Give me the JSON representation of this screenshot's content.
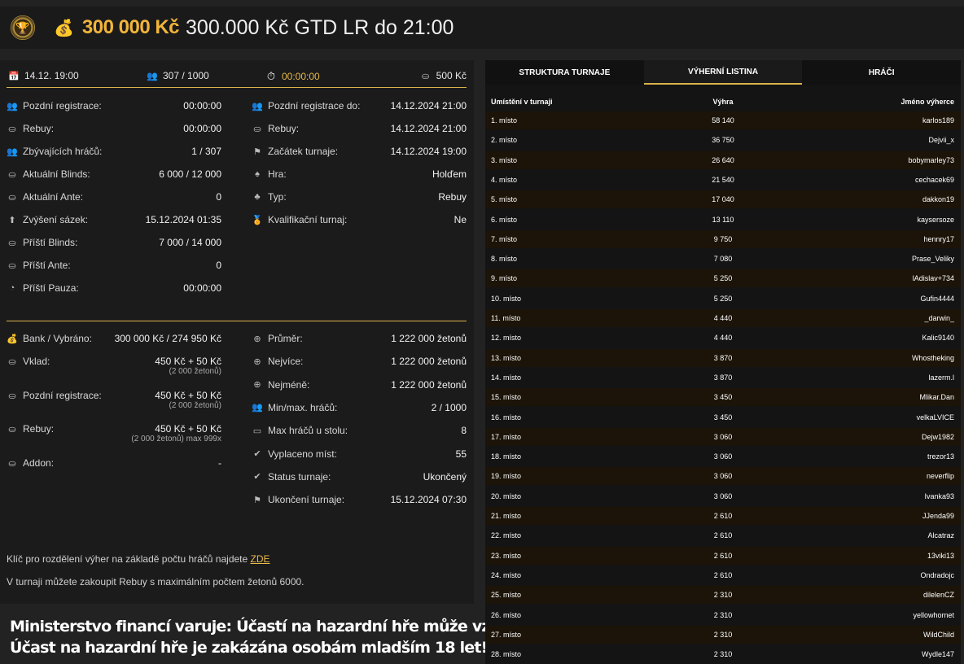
{
  "header": {
    "logo_icon": "trophy-chip-icon",
    "prize": "300 000 Kč",
    "title": "300.000 Kč GTD LR do 21:00"
  },
  "topbar": {
    "date": "14.12. 19:00",
    "players": "307 / 1000",
    "timer": "00:00:00",
    "buyin": "500 Kč"
  },
  "info_left": [
    {
      "label": "Pozdní registrace:",
      "value": "00:00:00"
    },
    {
      "label": "Rebuy:",
      "value": "00:00:00"
    },
    {
      "label": "Zbývajících hráčů:",
      "value": "1 / 307"
    },
    {
      "label": "Aktuální Blinds:",
      "value": "6 000 / 12 000"
    },
    {
      "label": "Aktuální Ante:",
      "value": "0"
    },
    {
      "label": "Zvýšení sázek:",
      "value": "15.12.2024 01:35"
    },
    {
      "label": "Příští Blinds:",
      "value": "7 000 / 14 000"
    },
    {
      "label": "Příští Ante:",
      "value": "0"
    },
    {
      "label": "Příští Pauza:",
      "value": "00:00:00"
    }
  ],
  "info_right": [
    {
      "label": "Pozdní registrace do:",
      "value": "14.12.2024 21:00"
    },
    {
      "label": "Rebuy:",
      "value": "14.12.2024 21:00"
    },
    {
      "label": "Začátek turnaje:",
      "value": "14.12.2024 19:00"
    },
    {
      "label": "Hra:",
      "value": "Holďem"
    },
    {
      "label": "Typ:",
      "value": "Rebuy"
    },
    {
      "label": "Kvalifikační turnaj:",
      "value": "Ne"
    }
  ],
  "money_left": [
    {
      "label": "Bank / Vybráno:",
      "value": "300 000 Kč / 274 950 Kč",
      "sub": ""
    },
    {
      "label": "Vklad:",
      "value": "450 Kč + 50 Kč",
      "sub": "(2 000 žetonů)"
    },
    {
      "label": "Pozdní registrace:",
      "value": "450 Kč + 50 Kč",
      "sub": "(2 000 žetonů)"
    },
    {
      "label": "Rebuy:",
      "value": "450 Kč + 50 Kč",
      "sub": "(2 000 žetonů) max 999x"
    },
    {
      "label": "Addon:",
      "value": "-",
      "sub": ""
    }
  ],
  "money_right": [
    {
      "label": "Průměr:",
      "value": "1 222 000 žetonů"
    },
    {
      "label": "Nejvíce:",
      "value": "1 222 000 žetonů"
    },
    {
      "label": "Nejméně:",
      "value": "1 222 000 žetonů"
    },
    {
      "label": "Min/max. hráčů:",
      "value": "2 / 1000"
    },
    {
      "label": "Max hráčů u stolu:",
      "value": "8"
    },
    {
      "label": "Vyplaceno míst:",
      "value": "55"
    },
    {
      "label": "Status turnaje:",
      "value": "Ukončený"
    },
    {
      "label": "Ukončení turnaje:",
      "value": "15.12.2024 07:30"
    }
  ],
  "notes": {
    "line1": "Klíč pro rozdělení výher na základě počtu hráčů najdete",
    "link": "ZDE",
    "line2": "V turnaji můžete zakoupit Rebuy s maximálním počtem žetonů 6000."
  },
  "warning": {
    "line1": "Ministerstvo financí varuje: Účastí na hazardní hře může vzniknout závislost!",
    "line2": "Účast na hazardní hře je zakázána osobám mladším 18 let!"
  },
  "tabs": [
    "STRUKTURA TURNAJE",
    "VÝHERNÍ LISTINA",
    "HRÁČI"
  ],
  "table": {
    "headers": [
      "Umístění v turnaji",
      "Výhra",
      "Jméno výherce"
    ],
    "rows": [
      [
        "1. místo",
        "58 140",
        "karlos189"
      ],
      [
        "2. místo",
        "36 750",
        "Dejvii_x"
      ],
      [
        "3. místo",
        "26 640",
        "bobymarley73"
      ],
      [
        "4. místo",
        "21 540",
        "cechacek69"
      ],
      [
        "5. místo",
        "17 040",
        "dakkon19"
      ],
      [
        "6. místo",
        "13 110",
        "kaysersoze"
      ],
      [
        "7. místo",
        "9 750",
        "hennry17"
      ],
      [
        "8. místo",
        "7 080",
        "Prase_Veliky"
      ],
      [
        "9. místo",
        "5 250",
        "lAdislav+734"
      ],
      [
        "10. místo",
        "5 250",
        "Gufin4444"
      ],
      [
        "11. místo",
        "4 440",
        "_darwin_"
      ],
      [
        "12. místo",
        "4 440",
        "Kalic9140"
      ],
      [
        "13. místo",
        "3 870",
        "Whostheking"
      ],
      [
        "14. místo",
        "3 870",
        "lazerm.l"
      ],
      [
        "15. místo",
        "3 450",
        "Mlikar.Dan"
      ],
      [
        "16. místo",
        "3 450",
        "velkaLVICE"
      ],
      [
        "17. místo",
        "3 060",
        "Dejw1982"
      ],
      [
        "18. místo",
        "3 060",
        "trezor13"
      ],
      [
        "19. místo",
        "3 060",
        "neverflip"
      ],
      [
        "20. místo",
        "3 060",
        "Ivanka93"
      ],
      [
        "21. místo",
        "2 610",
        "JJenda99"
      ],
      [
        "22. místo",
        "2 610",
        "Alcatraz"
      ],
      [
        "23. místo",
        "2 610",
        "13viki13"
      ],
      [
        "24. místo",
        "2 610",
        "Ondradojc"
      ],
      [
        "25. místo",
        "2 310",
        "dilelenCZ"
      ],
      [
        "26. místo",
        "2 310",
        "yellowhornet"
      ],
      [
        "27. místo",
        "2 310",
        "WildChild"
      ],
      [
        "28. místo",
        "2 310",
        "Wydle147"
      ]
    ]
  }
}
